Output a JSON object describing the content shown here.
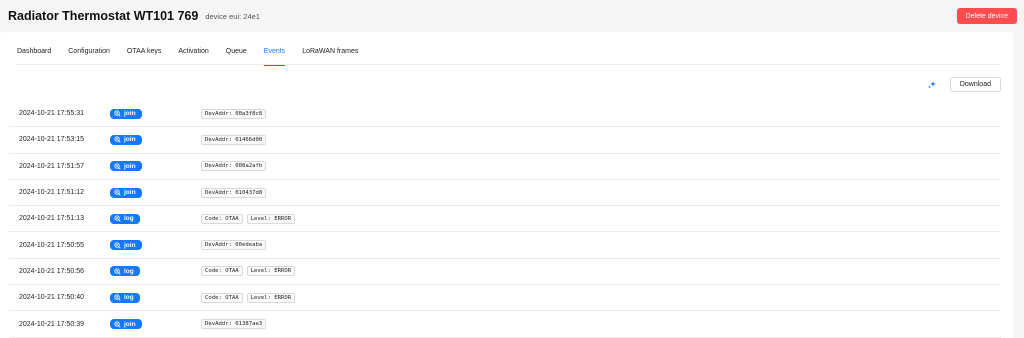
{
  "header": {
    "title": "Radiator Thermostat WT101 769",
    "eui_label": "device eui: 24e1",
    "delete_label": "Delete device"
  },
  "tabs": [
    {
      "label": "Dashboard"
    },
    {
      "label": "Configuration"
    },
    {
      "label": "OTAA keys"
    },
    {
      "label": "Activation"
    },
    {
      "label": "Queue"
    },
    {
      "label": "Events",
      "active": true
    },
    {
      "label": "LoRaWAN frames"
    }
  ],
  "toolbar": {
    "download_label": "Download",
    "sparkle_icon": "sparkle-icon"
  },
  "colors": {
    "accent": "#1677ff",
    "danger": "#ff4d4f"
  },
  "events": [
    {
      "time": "2024-10-21 17:55:31",
      "type": "join",
      "tags": [
        "DevAddr: 00a3f8c8"
      ]
    },
    {
      "time": "2024-10-21 17:53:15",
      "type": "join",
      "tags": [
        "DevAddr: 01466d00"
      ]
    },
    {
      "time": "2024-10-21 17:51:57",
      "type": "join",
      "tags": [
        "DevAddr: 008a2afb"
      ]
    },
    {
      "time": "2024-10-21 17:51:12",
      "type": "join",
      "tags": [
        "DevAddr: 010437d8"
      ]
    },
    {
      "time": "2024-10-21 17:51:13",
      "type": "log",
      "tags": [
        "Code: OTAA",
        "Level: ERROR"
      ]
    },
    {
      "time": "2024-10-21 17:50:55",
      "type": "join",
      "tags": [
        "DevAddr: 00edeaba"
      ]
    },
    {
      "time": "2024-10-21 17:50:56",
      "type": "log",
      "tags": [
        "Code: OTAA",
        "Level: ERROR"
      ]
    },
    {
      "time": "2024-10-21 17:50:40",
      "type": "log",
      "tags": [
        "Code: OTAA",
        "Level: ERROR"
      ]
    },
    {
      "time": "2024-10-21 17:50:39",
      "type": "join",
      "tags": [
        "DevAddr: 01387ae3"
      ]
    }
  ]
}
